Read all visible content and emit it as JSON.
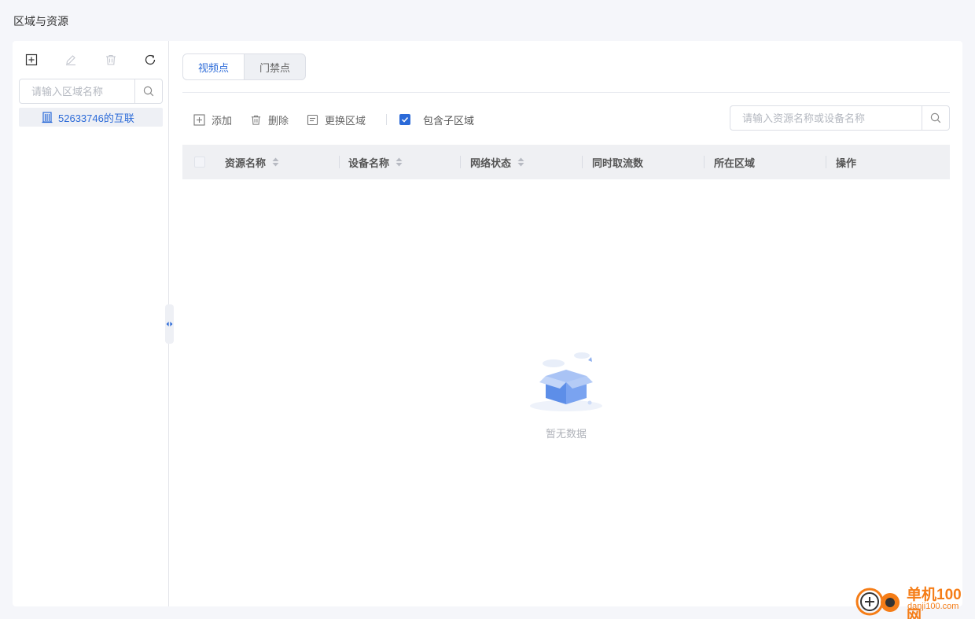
{
  "page": {
    "title": "区域与资源"
  },
  "tree": {
    "toolbar": {
      "add_icon": "plus-square-icon",
      "edit_icon": "pencil-icon",
      "delete_icon": "trash-icon",
      "refresh_icon": "refresh-icon"
    },
    "search": {
      "placeholder": "请输入区域名称",
      "value": ""
    },
    "nodes": [
      {
        "label": "52633746的互联",
        "icon": "building-icon",
        "selected": true
      }
    ]
  },
  "tabs": [
    {
      "label": "视频点",
      "active": true
    },
    {
      "label": "门禁点",
      "active": false
    }
  ],
  "actions": {
    "add": "添加",
    "delete": "删除",
    "change_area": "更换区域",
    "include_sub": {
      "label": "包含子区域",
      "checked": true
    }
  },
  "resource_search": {
    "placeholder": "请输入资源名称或设备名称",
    "value": ""
  },
  "table": {
    "columns": [
      {
        "label": "资源名称",
        "sortable": true
      },
      {
        "label": "设备名称",
        "sortable": true
      },
      {
        "label": "网络状态",
        "sortable": true
      },
      {
        "label": "同时取流数",
        "sortable": false
      },
      {
        "label": "所在区域",
        "sortable": false
      },
      {
        "label": "操作",
        "sortable": false
      }
    ],
    "rows": [],
    "empty_text": "暂无数据"
  },
  "watermark": {
    "title": "单机100网",
    "url": "danji100.com"
  },
  "colors": {
    "accent": "#2b6ad8",
    "background": "#f5f6fa",
    "header_bg": "#eff0f3",
    "watermark": "#f57d17"
  }
}
